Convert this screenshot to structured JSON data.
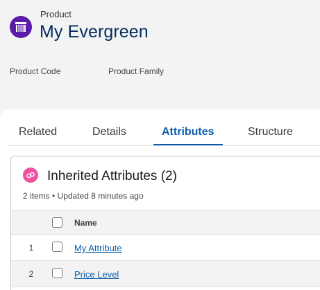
{
  "header": {
    "entity_label": "Product",
    "record_title": "My Evergreen",
    "icon": "product-icon",
    "fields": [
      {
        "label": "Product Code"
      },
      {
        "label": "Product Family"
      }
    ]
  },
  "tabs": [
    {
      "label": "Related"
    },
    {
      "label": "Details"
    },
    {
      "label": "Attributes",
      "active": true
    },
    {
      "label": "Structure"
    }
  ],
  "related_list": {
    "icon": "attributes-icon",
    "title": "Inherited Attributes (2)",
    "meta": "2 items • Updated 8 minutes ago",
    "columns": [
      "Name"
    ],
    "rows": [
      {
        "num": "1",
        "name": "My Attribute"
      },
      {
        "num": "2",
        "name": "Price Level"
      }
    ]
  },
  "colors": {
    "brand_purple": "#5a1ba9",
    "link_blue": "#0b5cab",
    "title_navy": "#032d60",
    "list_icon_pink": "#f0529f"
  }
}
